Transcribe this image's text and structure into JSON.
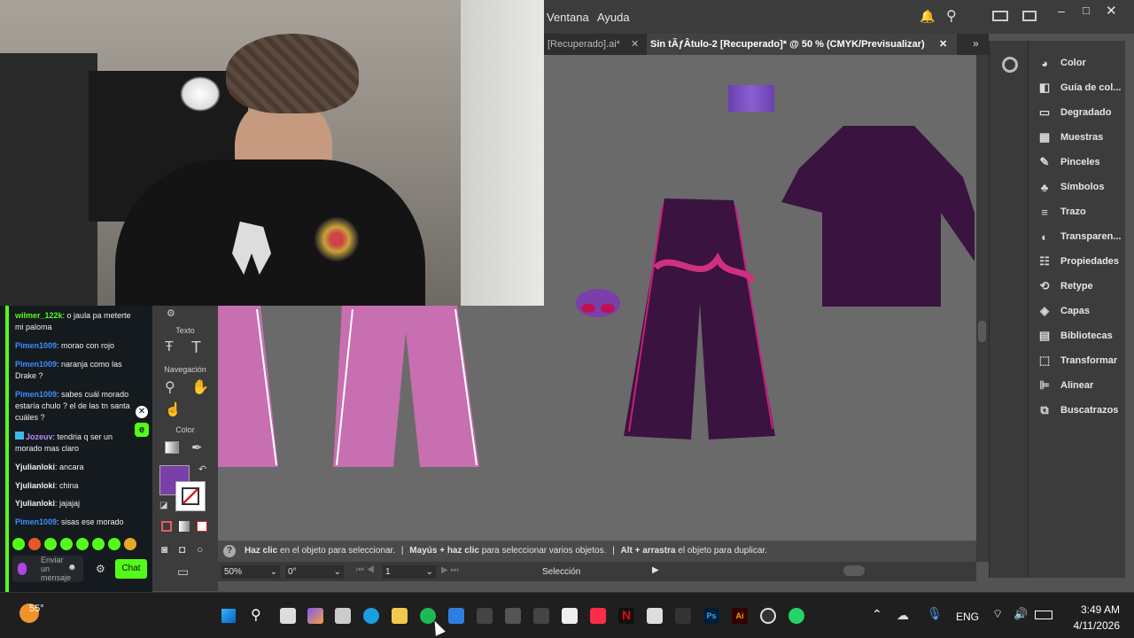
{
  "menu": {
    "items": [
      "Ventana",
      "Ayuda"
    ]
  },
  "tabs": {
    "inactive": "[Recuperado].ai*",
    "active": "Sin tÃƒÂtulo-2 [Recuperado]* @ 50 % (CMYK/Previsualizar)"
  },
  "panels": [
    "Color",
    "Guía de col...",
    "Degradado",
    "Muestras",
    "Pinceles",
    "Símbolos",
    "Trazo",
    "Transparen...",
    "Propiedades",
    "Retype",
    "Capas",
    "Bibliotecas",
    "Transformar",
    "Alinear",
    "Buscatrazos"
  ],
  "toolbar": {
    "texto_label": "Texto",
    "nav_label": "Navegación",
    "color_label": "Color"
  },
  "status": {
    "part1_bold": "Haz clic",
    "part1": " en el objeto para seleccionar.",
    "part2_bold": "Mayús + haz clic",
    "part2": " para seleccionar varios objetos.",
    "part3_bold": "Alt + arrastra",
    "part3": " el objeto para duplicar."
  },
  "bottom": {
    "zoom": "50%",
    "rotation": "0°",
    "artboard": "1",
    "tool": "Selección"
  },
  "chat": {
    "messages": [
      {
        "user": "wilmer_122k",
        "text": ": o jaula pa meterte mi paloma",
        "color": "#ffffff"
      },
      {
        "user": "Pimen1009",
        "text": ": morao con rojo",
        "color": "#3d8fff"
      },
      {
        "user": "Pimen1009",
        "text": ": naranja como las Drake ?",
        "color": "#3d8fff"
      },
      {
        "user": "Pimen1009",
        "text": ": sabes cuál morado estaría chulo ? el de las tn santa cuáles ?",
        "color": "#3d8fff"
      },
      {
        "user": "Jozeuv",
        "text": ": tendria q ser un morado mas claro",
        "color": "#b98cff"
      },
      {
        "user": "Yjulianloki",
        "text": ": ancara",
        "color": "#ffffff"
      },
      {
        "user": "Yjulianloki",
        "text": ": china",
        "color": "#ffffff"
      },
      {
        "user": "Yjulianloki",
        "text": ": jajajaj",
        "color": "#ffffff"
      },
      {
        "user": "Pimen1009",
        "text": ": sisas ese morado",
        "color": "#3d8fff"
      }
    ],
    "input_placeholder": "Enviar un mensaje",
    "send_label": "Chat"
  },
  "taskbar": {
    "weather_temp": "55°",
    "lang": "ENG",
    "time": "3:49 AM",
    "date": "4/11/2026"
  },
  "colors": {
    "fill": "#7a3fa8",
    "garment": "#3a1340",
    "pink": "#c76fb0",
    "accent_green": "#53fc18"
  }
}
